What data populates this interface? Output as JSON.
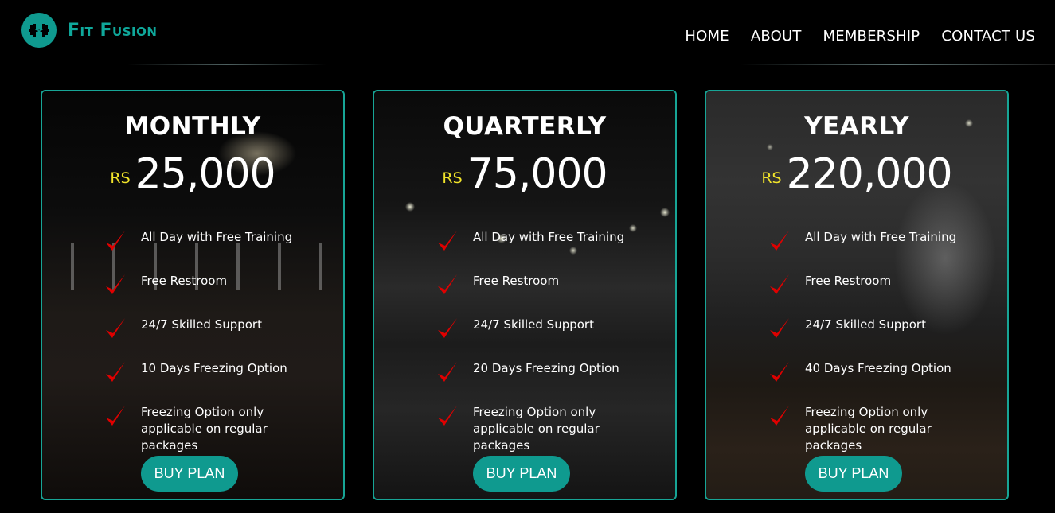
{
  "brand": {
    "name_first": "Fit",
    "name_second": "Fusion",
    "accent": "#0f9a8f",
    "icon": "dumbbell-icon"
  },
  "nav": {
    "items": [
      {
        "label": "HOME"
      },
      {
        "label": "ABOUT"
      },
      {
        "label": "MEMBERSHIP"
      },
      {
        "label": "CONTACT US"
      }
    ]
  },
  "plans": [
    {
      "title": "MONTHLY",
      "currency": "RS",
      "price": "25,000",
      "features": [
        "All Day with Free Training",
        "Free Restroom",
        "24/7 Skilled Support",
        "10 Days Freezing Option",
        "Freezing Option only applicable on regular packages"
      ],
      "button": "BUY PLAN"
    },
    {
      "title": "QUARTERLY",
      "currency": "RS",
      "price": "75,000",
      "features": [
        "All Day with Free Training",
        "Free Restroom",
        "24/7 Skilled Support",
        "20 Days Freezing Option",
        "Freezing Option only applicable on regular packages"
      ],
      "button": "BUY PLAN"
    },
    {
      "title": "YEARLY",
      "currency": "RS",
      "price": "220,000",
      "features": [
        "All Day with Free Training",
        "Free Restroom",
        "24/7 Skilled Support",
        "40 Days Freezing Option",
        "Freezing Option only applicable on regular packages"
      ],
      "button": "BUY PLAN"
    }
  ],
  "colors": {
    "background": "#000000",
    "card_border": "#17a596",
    "currency": "#f1e42a",
    "check": "#e00000",
    "button": "#0f9a8f"
  }
}
